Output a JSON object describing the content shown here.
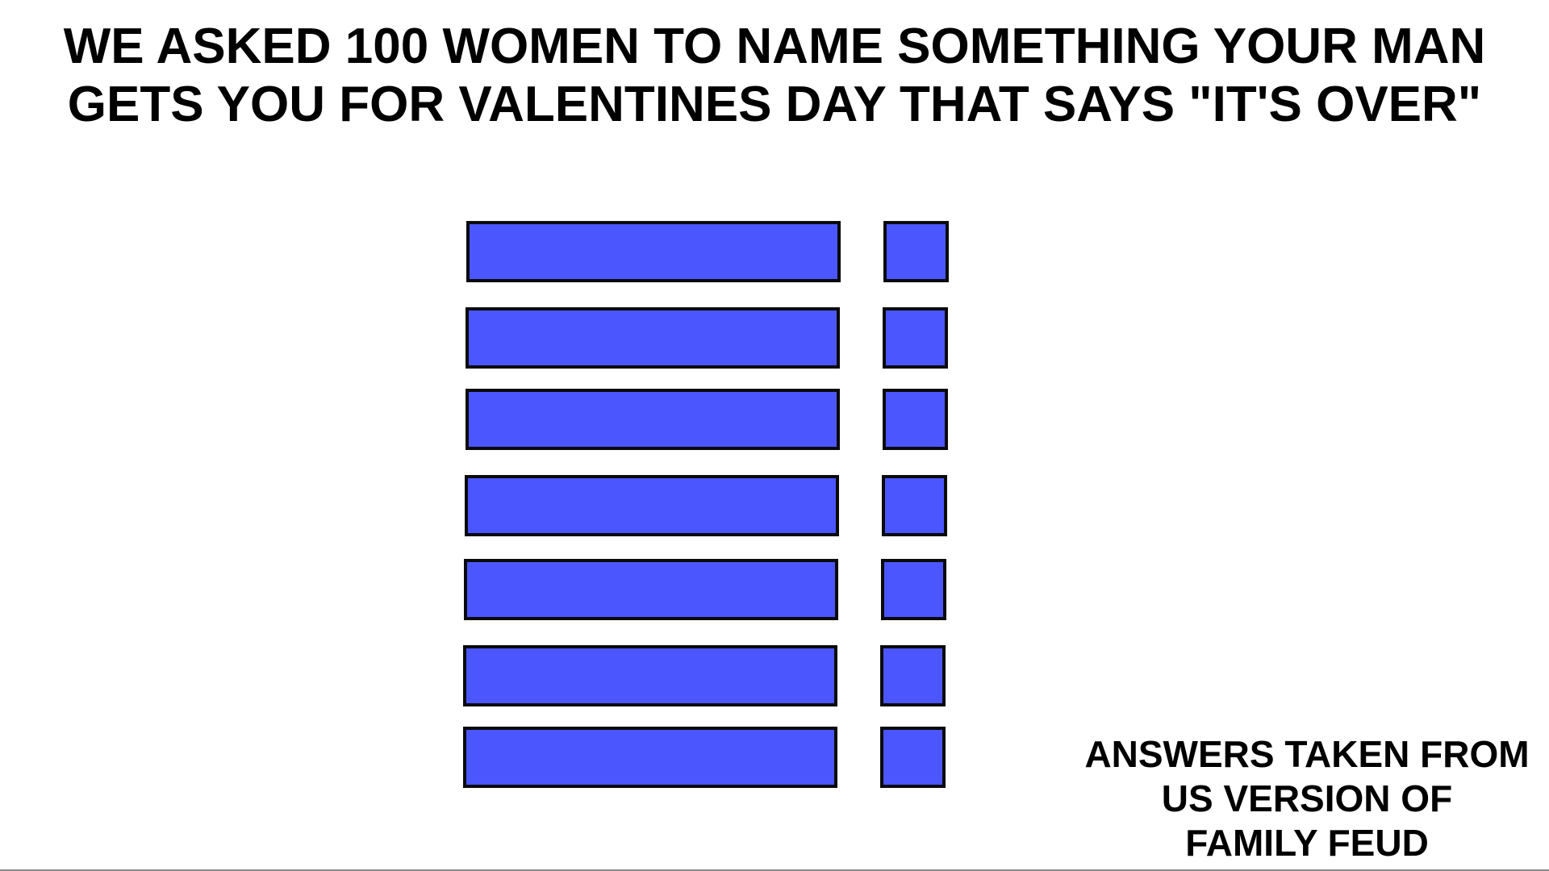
{
  "title": {
    "line1": "WE ASKED 100 WOMEN TO NAME SOMETHING YOUR MAN",
    "line2": "GETS YOU FOR VALENTINES DAY THAT SAYS \"IT'S OVER\""
  },
  "board": {
    "slot_color": "#4b56ff",
    "border_color": "#0a0a0a",
    "rows": [
      {
        "answer": "",
        "points": ""
      },
      {
        "answer": "",
        "points": ""
      },
      {
        "answer": "",
        "points": ""
      },
      {
        "answer": "",
        "points": ""
      },
      {
        "answer": "",
        "points": ""
      },
      {
        "answer": "",
        "points": ""
      },
      {
        "answer": "",
        "points": ""
      }
    ]
  },
  "credit": {
    "line1": "ANSWERS TAKEN FROM",
    "line2": "US VERSION OF",
    "line3": "FAMILY FEUD"
  }
}
